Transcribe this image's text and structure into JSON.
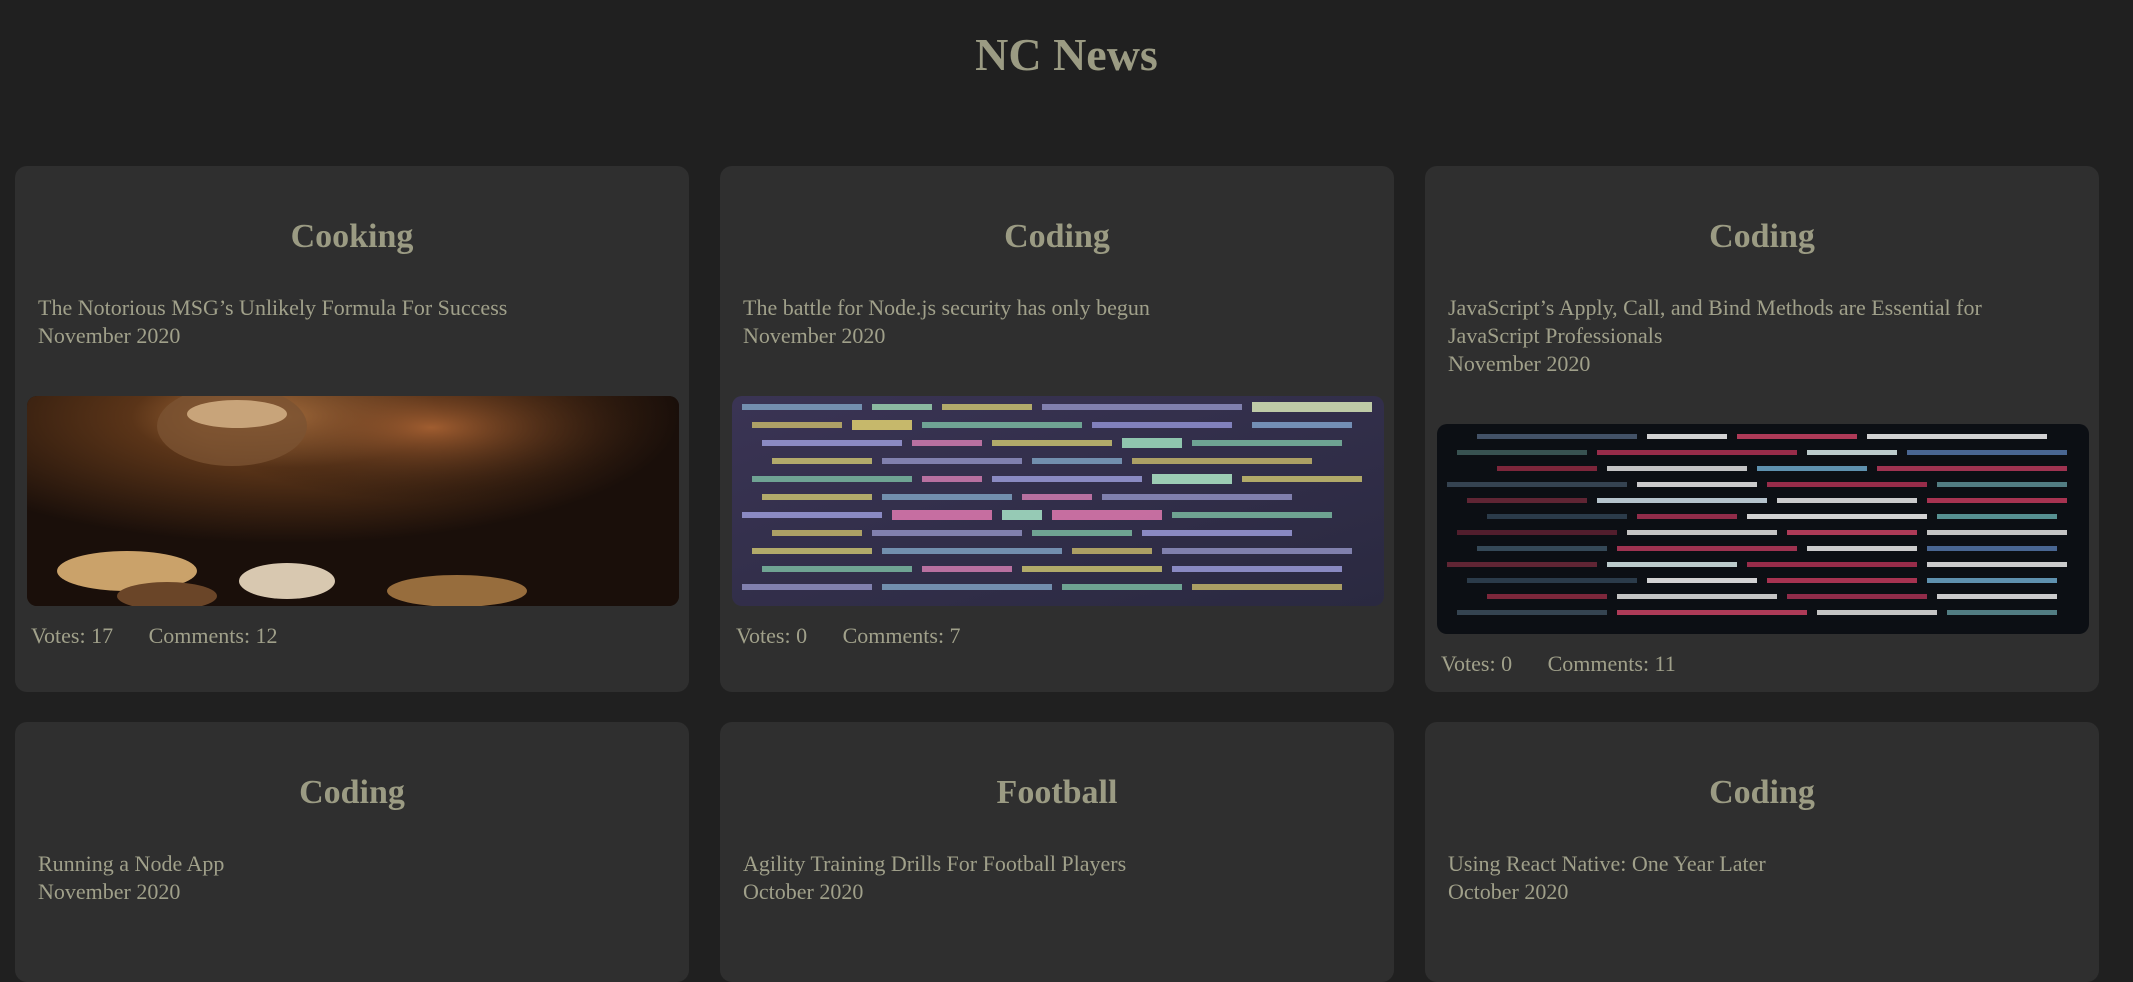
{
  "site": {
    "title": "NC News"
  },
  "articles": [
    {
      "topic": "Cooking",
      "title": "The Notorious MSG’s Unlikely Formula For Success",
      "date": "November 2020",
      "image": "cooking-photo",
      "votes_label": "Votes: 17",
      "comments_label": "Comments: 12"
    },
    {
      "topic": "Coding",
      "title": "The battle for Node.js security has only begun",
      "date": "November 2020",
      "image": "code-screen-photo",
      "votes_label": "Votes: 0",
      "comments_label": "Comments: 7"
    },
    {
      "topic": "Coding",
      "title": "JavaScript’s Apply, Call, and Bind Methods are Essential for JavaScript Professionals",
      "date": "November 2020",
      "image": "code-screen-photo",
      "votes_label": "Votes: 0",
      "comments_label": "Comments: 11"
    },
    {
      "topic": "Coding",
      "title": "Running a Node App",
      "date": "November 2020"
    },
    {
      "topic": "Football",
      "title": "Agility Training Drills For Football Players",
      "date": "October 2020"
    },
    {
      "topic": "Coding",
      "title": "Using React Native: One Year Later",
      "date": "October 2020"
    }
  ],
  "colors": {
    "background": "#202020",
    "card": "#2f2f2f",
    "text": "#9b9b83"
  }
}
